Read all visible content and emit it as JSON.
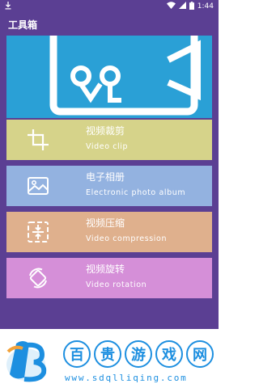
{
  "status_bar": {
    "time": "1:44",
    "download_icon": "download-icon",
    "wifi_icon": "wifi-icon",
    "signal_icon": "signal-icon",
    "battery_icon": "battery-icon"
  },
  "app_title": "工具箱",
  "banner": {
    "icon": "video-camera-logo"
  },
  "tools": [
    {
      "title": "视频裁剪",
      "subtitle": "Video clip",
      "icon": "crop-icon",
      "color": "#d6d38a"
    },
    {
      "title": "电子相册",
      "subtitle": "Electronic photo album",
      "icon": "photo-icon",
      "color": "#93b2e0"
    },
    {
      "title": "视频压缩",
      "subtitle": "Video compression",
      "icon": "compress-icon",
      "color": "#dfb08d"
    },
    {
      "title": "视频旋转",
      "subtitle": "Video rotation",
      "icon": "rotate-icon",
      "color": "#d58fd8"
    }
  ],
  "watermark": {
    "characters": [
      "百",
      "贵",
      "游",
      "戏",
      "网"
    ],
    "url": "www.sdqlliqing.com",
    "logo": "watermark-logo"
  },
  "colors": {
    "background": "#5b3f93",
    "accent": "#1d8fe0"
  }
}
